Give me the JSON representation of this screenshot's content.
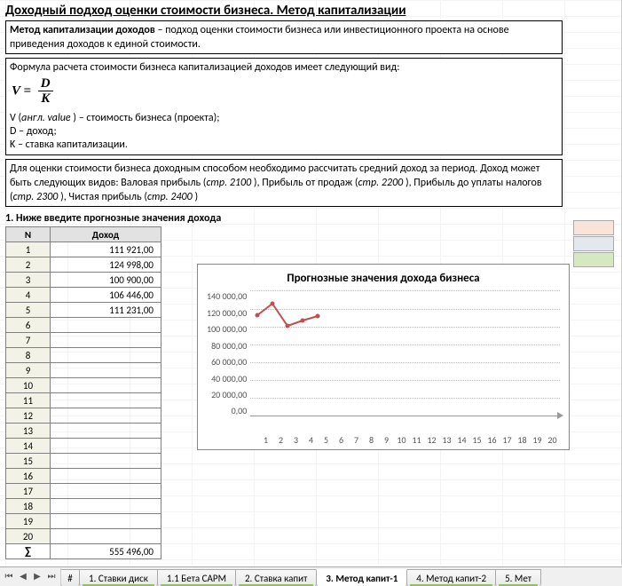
{
  "title": "Доходный подход оценки стоимости бизнеса. Метод капитализации",
  "intro": {
    "bold": "Метод капитализации доходов",
    "rest": " – подход оценки стоимости бизнеса или инвестиционного проекта на основе приведения доходов к единой стоимости."
  },
  "formula_block": {
    "line1": "Формула расчета стоимости бизнеса капитализацией доходов имеет следующий вид:",
    "v_label": "V =",
    "num": "D",
    "den": "K",
    "desc_v_pre": "V  (",
    "desc_v_it": "англ. value",
    "desc_v_post": " ) – стоимость бизнеса (проекта);",
    "desc_d": "D – доход;",
    "desc_k": "K – ставка капитализации."
  },
  "note_block": {
    "t1": "Для оценки стоимости бизнеса доходным способом необходимо рассчитать средний доход за период. Доход может быть следующих видов: Валовая прибыль (",
    "i1": "стр. 2100",
    "t2": " ), Прибыль от продаж (",
    "i2": "стр. 2200",
    "t3": " ), Прибыль до уплаты налогов (",
    "i3": "стр. 2300",
    "t4": " ), Чистая прибыль (",
    "i4": "стр. 2400",
    "t5": " )"
  },
  "section1": "1. Ниже введите прогнозные значения дохода",
  "table": {
    "h1": "N",
    "h2": "Доход",
    "rows": [
      {
        "n": "1",
        "v": "111 921,00"
      },
      {
        "n": "2",
        "v": "124 998,00"
      },
      {
        "n": "3",
        "v": "100 900,00"
      },
      {
        "n": "4",
        "v": "106 446,00"
      },
      {
        "n": "5",
        "v": "111 231,00"
      },
      {
        "n": "6",
        "v": ""
      },
      {
        "n": "7",
        "v": ""
      },
      {
        "n": "8",
        "v": ""
      },
      {
        "n": "9",
        "v": ""
      },
      {
        "n": "10",
        "v": ""
      },
      {
        "n": "11",
        "v": ""
      },
      {
        "n": "12",
        "v": ""
      },
      {
        "n": "13",
        "v": ""
      },
      {
        "n": "14",
        "v": ""
      },
      {
        "n": "15",
        "v": ""
      },
      {
        "n": "16",
        "v": ""
      },
      {
        "n": "17",
        "v": ""
      },
      {
        "n": "18",
        "v": ""
      },
      {
        "n": "19",
        "v": ""
      },
      {
        "n": "20",
        "v": ""
      }
    ],
    "sum_label": "∑",
    "sum_value": "555 496,00"
  },
  "chart": {
    "title": "Прогнозные значения дохода бизнеса",
    "yticks": [
      "140 000,00",
      "120 000,00",
      "100 000,00",
      "80 000,00",
      "60 000,00",
      "40 000,00",
      "20 000,00",
      "0,00"
    ],
    "xticks": [
      "1",
      "2",
      "3",
      "4",
      "5",
      "6",
      "7",
      "8",
      "9",
      "10",
      "11",
      "12",
      "13",
      "14",
      "15",
      "16",
      "17",
      "18",
      "19",
      "20"
    ]
  },
  "chart_data": {
    "type": "line",
    "title": "Прогнозные значения дохода бизнеса",
    "xlabel": "",
    "ylabel": "",
    "x": [
      1,
      2,
      3,
      4,
      5
    ],
    "values": [
      111921,
      124998,
      100900,
      106446,
      111231
    ],
    "ylim": [
      0,
      140000
    ],
    "xlim": [
      1,
      20
    ]
  },
  "swatches": [
    "#f8e4d8",
    "#e2e8ee",
    "#d6e8c0"
  ],
  "tabs": {
    "t0": "#",
    "t1": "1. Ставки диск",
    "t2": "1.1 Бета CAPM",
    "t3": "2. Ставка капит",
    "t4": "3. Метод капит-1",
    "t5": "4. Метод капит-2",
    "t6": "5. Мет"
  }
}
